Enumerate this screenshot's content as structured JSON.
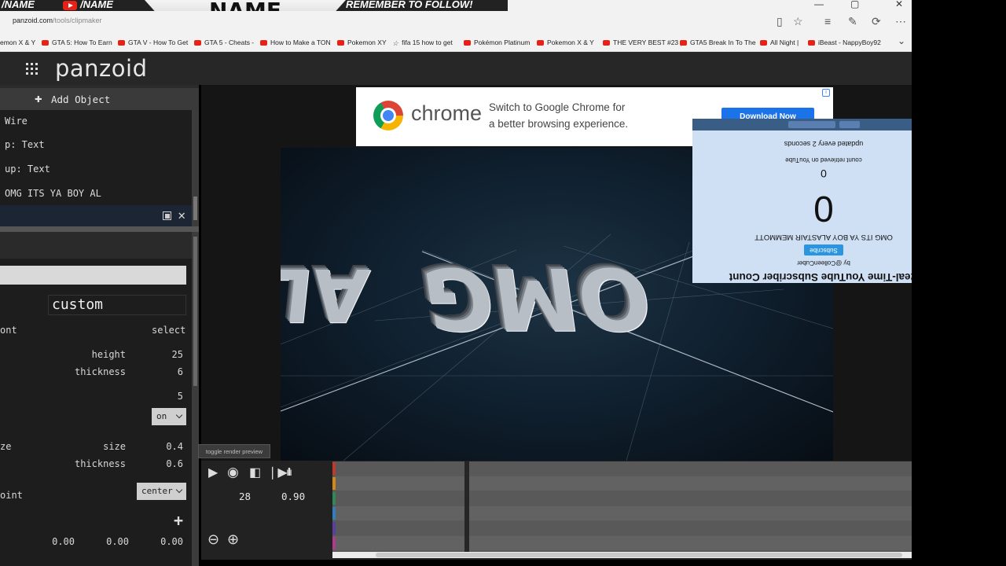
{
  "banner": {
    "left_handle": "/NAME",
    "handle": "/NAME",
    "name_plate": "NAME",
    "follow_text": "REMEMBER TO FOLLOW!"
  },
  "browser": {
    "url_host": "panzoid.com",
    "url_path": "/tools/clipmaker",
    "window_buttons": [
      "—",
      "▢",
      "✕"
    ],
    "toolbar_icons": [
      "reading-view-icon",
      "favorite-star-icon",
      "hub-icon",
      "web-note-icon",
      "share-icon",
      "more-icon"
    ],
    "favorites": [
      {
        "label": "emon X & Y",
        "icon": "youtube"
      },
      {
        "label": "GTA 5: How To Earn",
        "icon": "youtube"
      },
      {
        "label": "GTA V - How To Get",
        "icon": "youtube"
      },
      {
        "label": "GTA 5 - Cheats -",
        "icon": "youtube"
      },
      {
        "label": "How to Make a TON",
        "icon": "youtube"
      },
      {
        "label": "Pokemon XY",
        "icon": "youtube"
      },
      {
        "label": "fifa 15 how to get",
        "icon": "star"
      },
      {
        "label": "Pokémon Platinum",
        "icon": "youtube"
      },
      {
        "label": "Pokemon X & Y",
        "icon": "youtube"
      },
      {
        "label": "THE VERY BEST #23 |",
        "icon": "youtube"
      },
      {
        "label": "GTA5 Break In To The",
        "icon": "youtube"
      },
      {
        "label": "All Night |",
        "icon": "youtube"
      },
      {
        "label": "iBeast - NappyBoy92",
        "icon": "youtube"
      }
    ]
  },
  "app": {
    "logo": "panzoid"
  },
  "objects": {
    "add_label": "Add Object",
    "items": [
      {
        "label": "Wire"
      },
      {
        "label": "p: Text"
      },
      {
        "label": "up: Text"
      },
      {
        "label": "OMG ITS YA BOY AL"
      }
    ]
  },
  "props": {
    "font_value": "custom",
    "font_label": "ont",
    "font_action": "select",
    "height_label": "height",
    "height_value": "25",
    "thickness_label": "thickness",
    "thickness_value": "6",
    "curve_value": "5",
    "bevel_value": "on",
    "bevel_label": "ze",
    "size_label": "size",
    "size_value": "0.4",
    "bevel_thickness_label": "thickness",
    "bevel_thickness_value": "0.6",
    "anchor_label": "oint",
    "anchor_value": "center",
    "pos_x": "0.00",
    "pos_y": "0.00",
    "pos_z": "0.00"
  },
  "ad": {
    "brand": "chrome",
    "line1": "Switch to Google Chrome for",
    "line2": "a better browsing experience.",
    "button": "Download Now"
  },
  "scene": {
    "text_left": "AL",
    "text_right": "OMG"
  },
  "counter": {
    "bar_chips": [
      "t (rand) @Colleenscount",
      "share"
    ],
    "title": "Real-Time YouTube Subscriber Count",
    "by": "by @ColleenCuber",
    "subscribe": "Subscribe",
    "channel": "OMG ITS YA BOY ALASTAIR MEMMOTT",
    "big_count": "0",
    "retrieved_label": "count retrieved on YouTube",
    "retrieved_value": "0",
    "updated": "updated every 2 seconds"
  },
  "timeline": {
    "tooltip": "toggle render preview",
    "frame": "28",
    "time": "0.90",
    "track_colors": [
      "#c0392b",
      "#d68910",
      "#2e8b57",
      "#2f80c0",
      "#5b3fa0",
      "#b03a8c"
    ]
  }
}
